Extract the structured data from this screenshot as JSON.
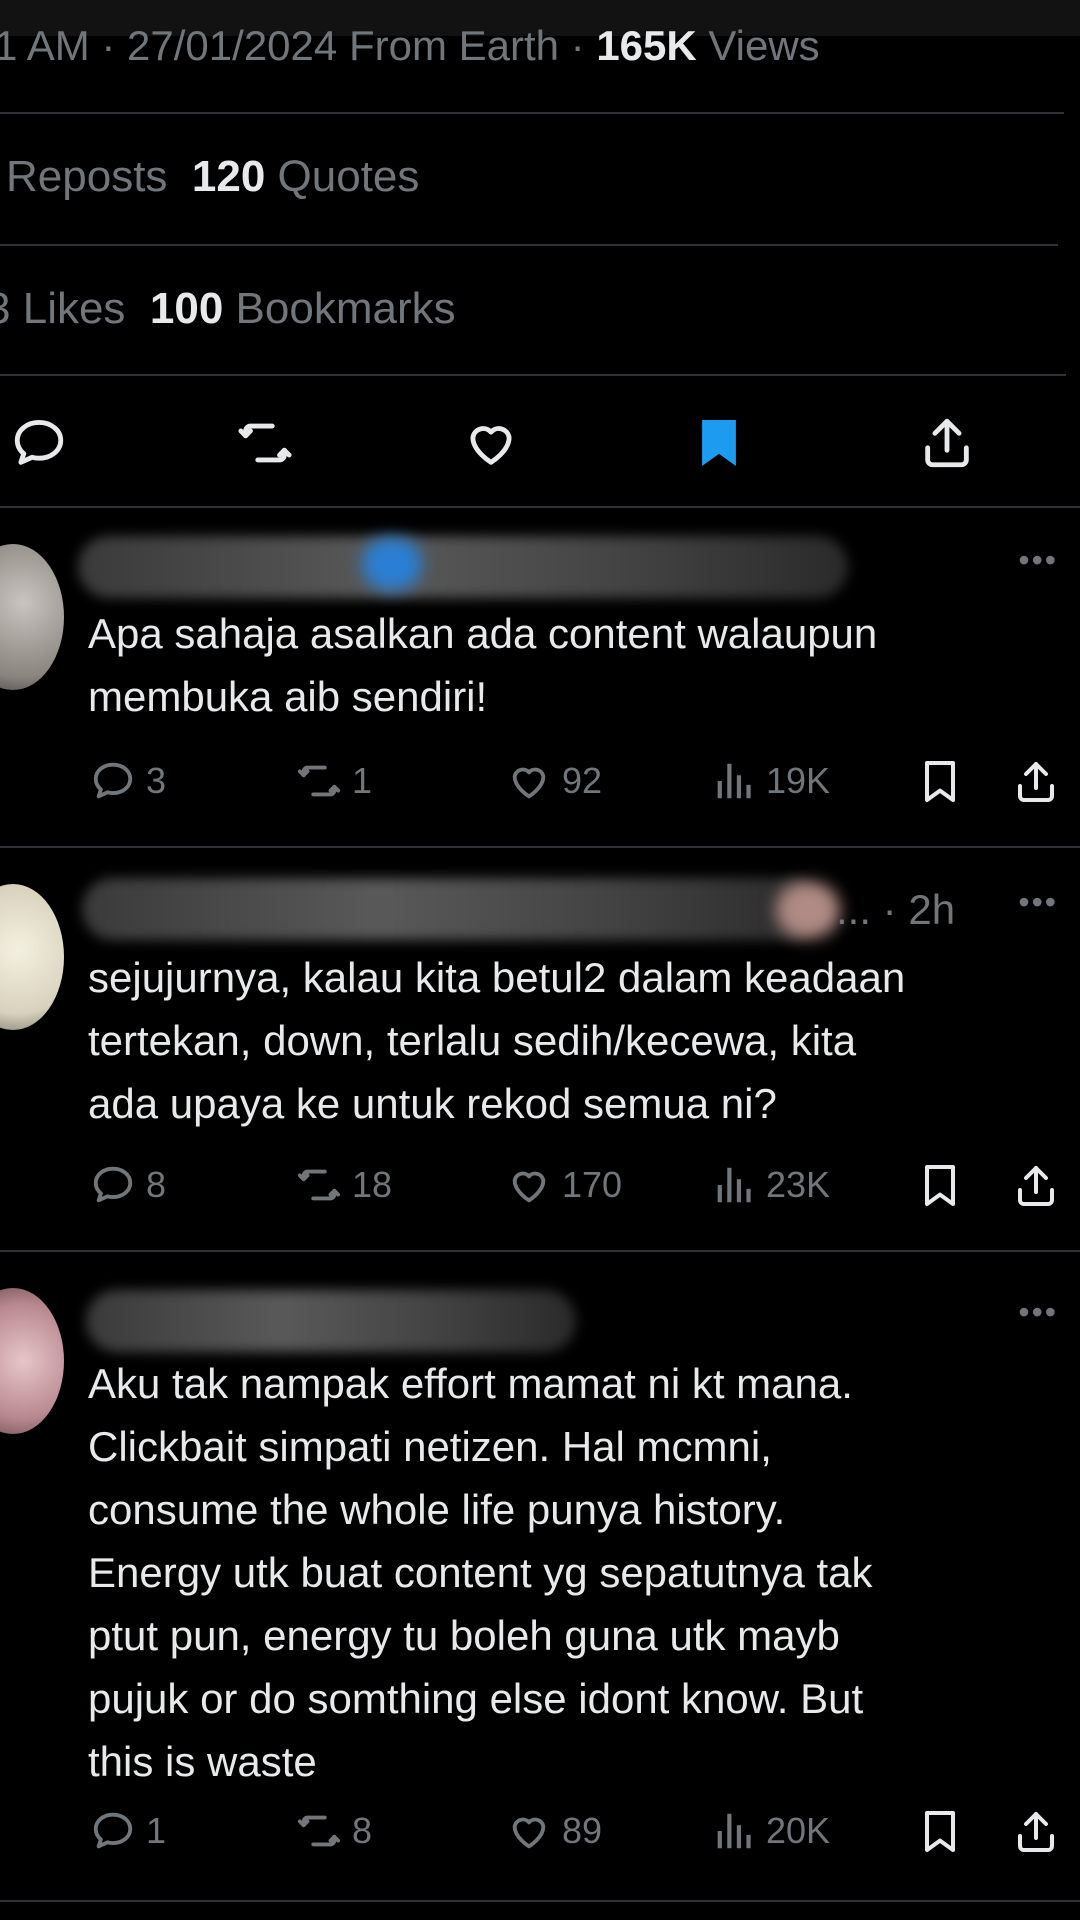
{
  "header": {
    "time_partial": "1 AM",
    "date": "27/01/2024",
    "source": "From Earth",
    "views_count": "165K",
    "views_label": "Views"
  },
  "stats": {
    "reposts_label": "Reposts",
    "quotes_count": "120",
    "quotes_label": "Quotes",
    "likes_count_partial": "3",
    "likes_label": "Likes",
    "bookmarks_count": "100",
    "bookmarks_label": "Bookmarks"
  },
  "actions": {
    "icons": [
      "reply-icon",
      "repost-icon",
      "like-icon",
      "bookmark-filled-icon",
      "share-icon"
    ],
    "bookmark_active_color": "#1d9bf0"
  },
  "replies": [
    {
      "text": "Apa sahaja asalkan ada content walaupun\nmembuka aib sendiri!",
      "time": "",
      "replies": "3",
      "reposts": "1",
      "likes": "92",
      "views": "19K"
    },
    {
      "text": "sejujurnya, kalau kita betul2 dalam keadaan\ntertekan, down, terlalu sedih/kecewa, kita\nada upaya ke untuk rekod semua ni?",
      "time": "... · 2h",
      "replies": "8",
      "reposts": "18",
      "likes": "170",
      "views": "23K"
    },
    {
      "text": "Aku tak nampak effort mamat ni kt mana.\nClickbait simpati netizen. Hal mcmni,\nconsume the whole life punya history.\nEnergy utk buat content yg sepatutnya tak\nptut pun, energy tu boleh guna utk mayb\npujuk or do somthing else idont know. But\nthis is waste",
      "time": "",
      "replies": "1",
      "reposts": "8",
      "likes": "89",
      "views": "20K"
    }
  ],
  "more_label": "•••",
  "colors": {
    "background": "#000000",
    "text": "#e7e9ea",
    "muted": "#71767b",
    "divider": "#2f3336"
  }
}
